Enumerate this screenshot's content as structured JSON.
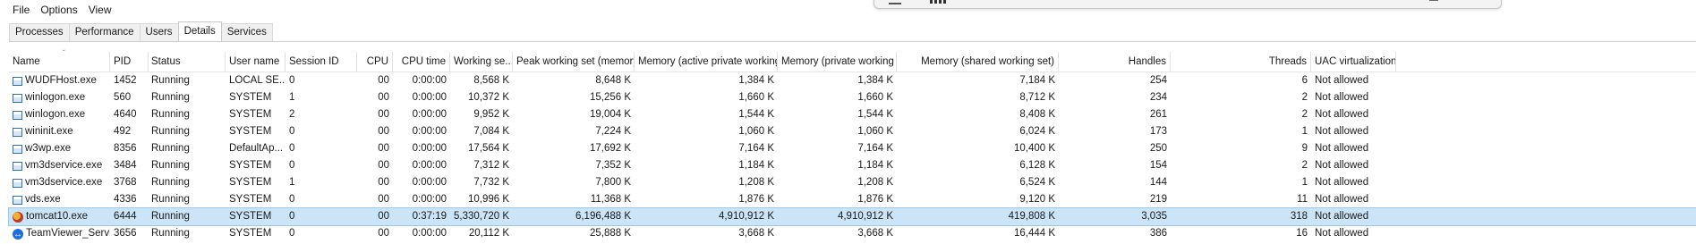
{
  "menu": [
    "File",
    "Options",
    "View"
  ],
  "tabs": [
    "Processes",
    "Performance",
    "Users",
    "Details",
    "Services"
  ],
  "active_tab": "Details",
  "columns": [
    {
      "label": "Name",
      "align": "l"
    },
    {
      "label": "PID",
      "align": "l"
    },
    {
      "label": "Status",
      "align": "l"
    },
    {
      "label": "User name",
      "align": "l"
    },
    {
      "label": "Session ID",
      "align": "l"
    },
    {
      "label": "CPU",
      "align": "r"
    },
    {
      "label": "CPU time",
      "align": "r"
    },
    {
      "label": "Working se...",
      "align": "r"
    },
    {
      "label": "Peak working set (memory)",
      "align": "r"
    },
    {
      "label": "Memory (active private working s...",
      "align": "r"
    },
    {
      "label": "Memory (private working ...",
      "align": "r"
    },
    {
      "label": "Memory (shared working set)",
      "align": "r"
    },
    {
      "label": "Handles",
      "align": "r"
    },
    {
      "label": "Threads",
      "align": "r"
    },
    {
      "label": "UAC virtualization",
      "align": "l"
    }
  ],
  "rows": [
    {
      "icon": "generic-process-icon",
      "cells": [
        "WUDFHost.exe",
        "1452",
        "Running",
        "LOCAL SE...",
        "0",
        "00",
        "0:00:00",
        "8,568 K",
        "8,648 K",
        "1,384 K",
        "1,384 K",
        "7,184 K",
        "254",
        "6",
        "Not allowed"
      ]
    },
    {
      "icon": "generic-process-icon",
      "cells": [
        "winlogon.exe",
        "560",
        "Running",
        "SYSTEM",
        "1",
        "00",
        "0:00:00",
        "10,372 K",
        "15,256 K",
        "1,660 K",
        "1,660 K",
        "8,712 K",
        "234",
        "2",
        "Not allowed"
      ]
    },
    {
      "icon": "generic-process-icon",
      "cells": [
        "winlogon.exe",
        "4640",
        "Running",
        "SYSTEM",
        "2",
        "00",
        "0:00:00",
        "9,952 K",
        "19,004 K",
        "1,544 K",
        "1,544 K",
        "8,408 K",
        "261",
        "2",
        "Not allowed"
      ]
    },
    {
      "icon": "generic-process-icon",
      "cells": [
        "wininit.exe",
        "492",
        "Running",
        "SYSTEM",
        "0",
        "00",
        "0:00:00",
        "7,084 K",
        "7,224 K",
        "1,060 K",
        "1,060 K",
        "6,024 K",
        "173",
        "1",
        "Not allowed"
      ]
    },
    {
      "icon": "generic-process-icon",
      "cells": [
        "w3wp.exe",
        "8356",
        "Running",
        "DefaultAp...",
        "0",
        "00",
        "0:00:00",
        "17,564 K",
        "17,692 K",
        "7,164 K",
        "7,164 K",
        "10,400 K",
        "250",
        "9",
        "Not allowed"
      ]
    },
    {
      "icon": "generic-process-icon",
      "cells": [
        "vm3dservice.exe",
        "3484",
        "Running",
        "SYSTEM",
        "0",
        "00",
        "0:00:00",
        "7,312 K",
        "7,352 K",
        "1,184 K",
        "1,184 K",
        "6,128 K",
        "154",
        "2",
        "Not allowed"
      ]
    },
    {
      "icon": "generic-process-icon",
      "cells": [
        "vm3dservice.exe",
        "3768",
        "Running",
        "SYSTEM",
        "1",
        "00",
        "0:00:00",
        "7,732 K",
        "7,800 K",
        "1,208 K",
        "1,208 K",
        "6,524 K",
        "144",
        "1",
        "Not allowed"
      ]
    },
    {
      "icon": "generic-process-icon",
      "cells": [
        "vds.exe",
        "4336",
        "Running",
        "SYSTEM",
        "0",
        "00",
        "0:00:00",
        "10,996 K",
        "11,368 K",
        "1,876 K",
        "1,876 K",
        "9,120 K",
        "219",
        "11",
        "Not allowed"
      ]
    },
    {
      "icon": "tomcat-icon",
      "selected": true,
      "cells": [
        "tomcat10.exe",
        "6444",
        "Running",
        "SYSTEM",
        "0",
        "00",
        "0:37:19",
        "5,330,720 K",
        "6,196,488 K",
        "4,910,912 K",
        "4,910,912 K",
        "419,808 K",
        "3,035",
        "318",
        "Not allowed"
      ]
    },
    {
      "icon": "teamviewer-icon",
      "cells": [
        "TeamViewer_Service....",
        "3656",
        "Running",
        "SYSTEM",
        "0",
        "00",
        "0:00:00",
        "20,112 K",
        "25,888 K",
        "3,668 K",
        "3,668 K",
        "16,444 K",
        "386",
        "16",
        "Not allowed"
      ]
    }
  ]
}
